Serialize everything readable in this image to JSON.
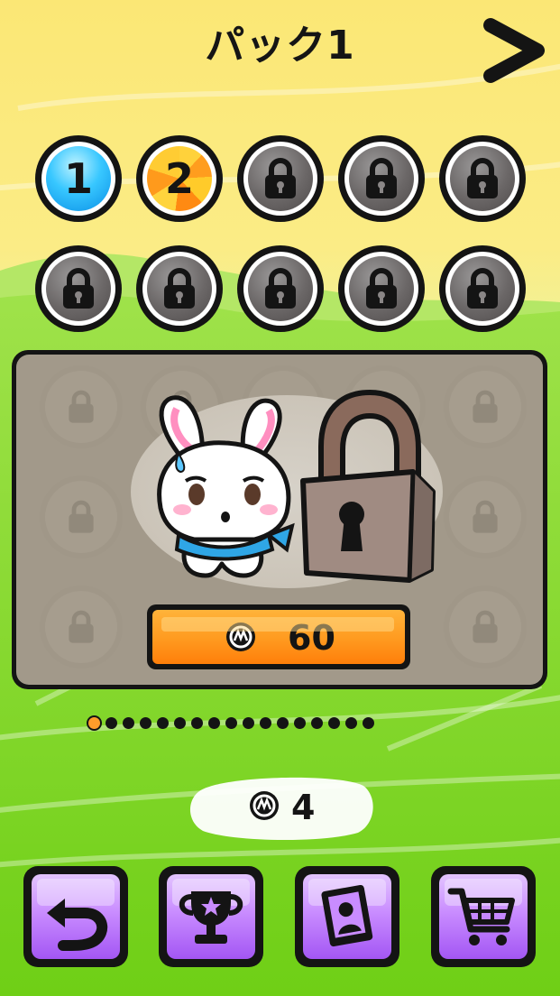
{
  "header": {
    "title": "パック1",
    "next_icon": "chevron-right-icon"
  },
  "levels": [
    {
      "number": "1",
      "state": "unlocked",
      "color": "#38c7ff"
    },
    {
      "number": "2",
      "state": "unlocked",
      "color": "#ff9d1e"
    },
    {
      "number": "",
      "state": "locked"
    },
    {
      "number": "",
      "state": "locked"
    },
    {
      "number": "",
      "state": "locked"
    },
    {
      "number": "",
      "state": "locked"
    },
    {
      "number": "",
      "state": "locked"
    },
    {
      "number": "",
      "state": "locked"
    },
    {
      "number": "",
      "state": "locked"
    },
    {
      "number": "",
      "state": "locked"
    }
  ],
  "locked_pack": {
    "character": "bunny-icon",
    "lock_icon": "padlock-icon",
    "unlock_price": "60",
    "currency_icon": "coin-icon"
  },
  "pagination": {
    "total_pages": 17,
    "current_page": 1,
    "active_color": "#ff9d2b"
  },
  "balance": {
    "coins": "4",
    "icon": "coin-icon"
  },
  "bottom_bar": [
    {
      "name": "back-button",
      "icon": "undo-arrow-icon"
    },
    {
      "name": "trophy-button",
      "icon": "trophy-icon"
    },
    {
      "name": "gallery-button",
      "icon": "photo-frame-icon"
    },
    {
      "name": "shop-button",
      "icon": "shopping-cart-icon"
    }
  ],
  "colors": {
    "sky": "#fff07a",
    "grass": "#8fe02c",
    "button_purple": "#b56cff",
    "price_orange": "#ff9a1f"
  }
}
